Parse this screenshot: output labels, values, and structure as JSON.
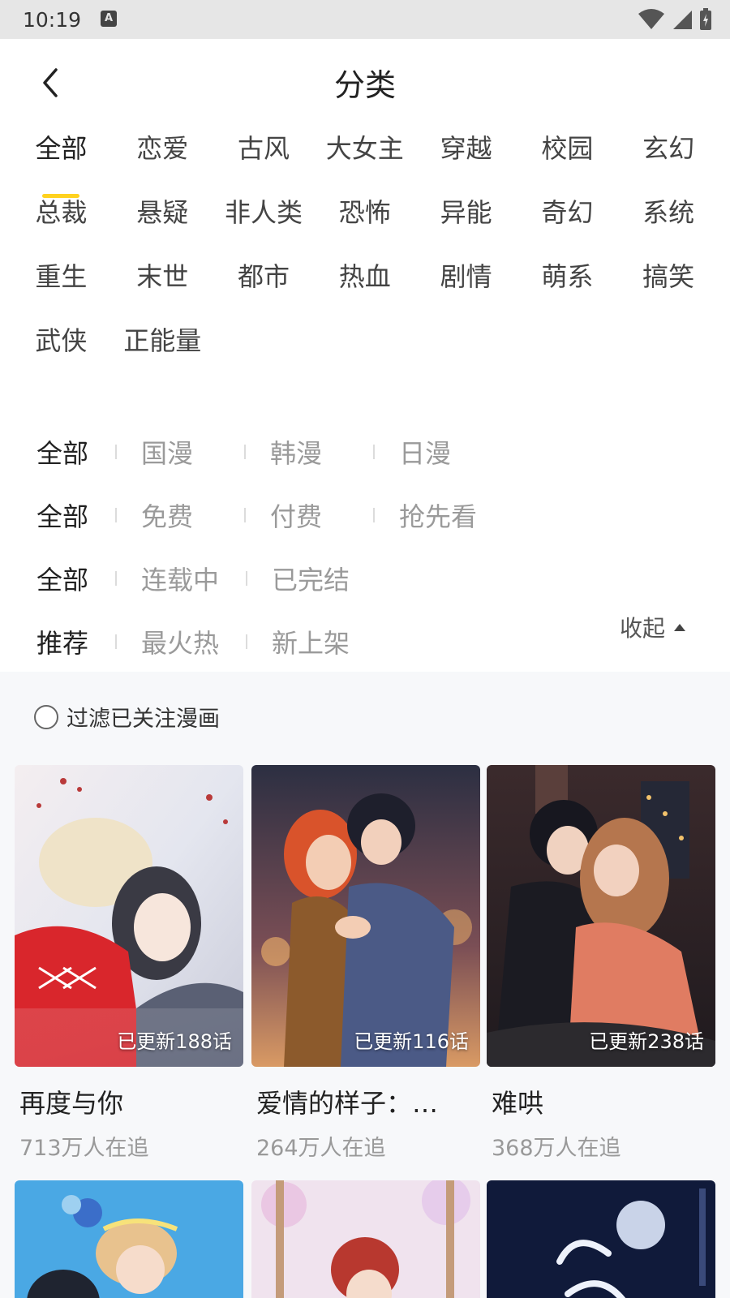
{
  "status_bar": {
    "time": "10:19",
    "notif_glyph": "A"
  },
  "header": {
    "title": "分类",
    "back_icon": "chevron-left-icon"
  },
  "genres": [
    "全部",
    "恋爱",
    "古风",
    "大女主",
    "穿越",
    "校园",
    "玄幻",
    "总裁",
    "悬疑",
    "非人类",
    "恐怖",
    "异能",
    "奇幻",
    "系统",
    "重生",
    "末世",
    "都市",
    "热血",
    "剧情",
    "萌系",
    "搞笑",
    "武侠",
    "正能量"
  ],
  "selected_genre": "全部",
  "filters": {
    "region": [
      "全部",
      "国漫",
      "韩漫",
      "日漫"
    ],
    "payment": [
      "全部",
      "免费",
      "付费",
      "抢先看"
    ],
    "status": [
      "全部",
      "连载中",
      "已完结"
    ],
    "sort": [
      "推荐",
      "最火热",
      "新上架"
    ]
  },
  "collapse_label": "收起",
  "follow_filter_label": "过滤已关注漫画",
  "comics": [
    {
      "title": "再度与你",
      "badge": "已更新188话",
      "followers": "713万人在追"
    },
    {
      "title": "爱情的样子：…",
      "badge": "已更新116话",
      "followers": "264万人在追"
    },
    {
      "title": "难哄",
      "badge": "已更新238话",
      "followers": "368万人在追"
    }
  ],
  "accent_color": "#ffd21f"
}
